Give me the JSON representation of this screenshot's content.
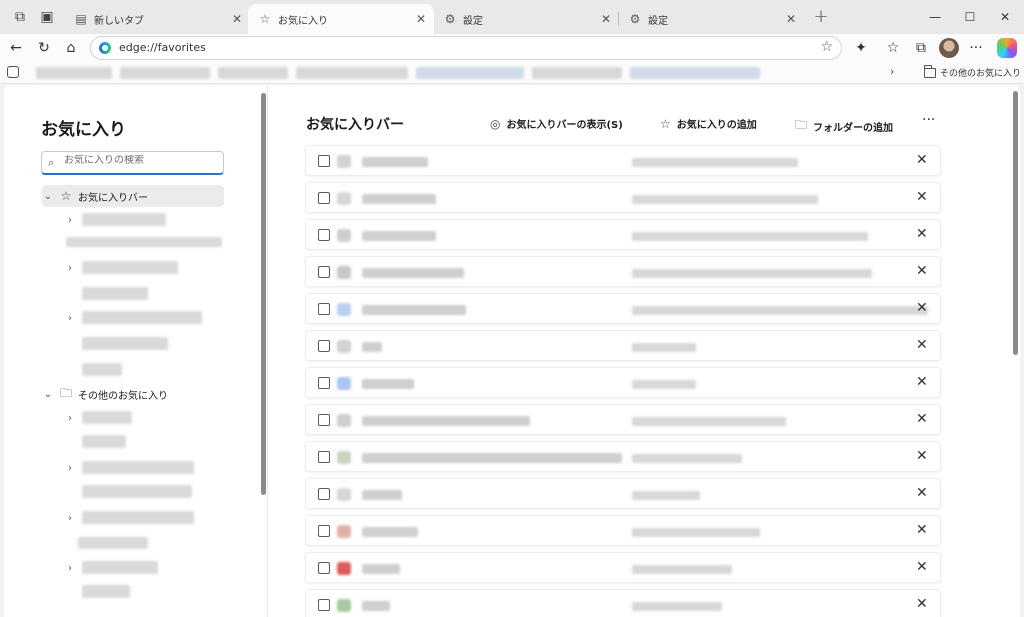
{
  "tabs": [
    {
      "label": "新しいタブ",
      "icon": "new-tab-page-icon",
      "active": false
    },
    {
      "label": "お気に入り",
      "icon": "star-icon",
      "active": true
    },
    {
      "label": "設定",
      "icon": "gear-icon",
      "active": false
    },
    {
      "label": "設定",
      "icon": "gear-icon",
      "active": false
    }
  ],
  "address": {
    "url": "edge://favorites"
  },
  "favorites_bar": {
    "other_favorites_label": "その他のお気に入り"
  },
  "sidebar": {
    "title": "お気に入り",
    "search_placeholder": "お気に入りの検索",
    "tree": {
      "favorites_bar_label": "お気に入りバー",
      "other_favorites_label": "その他のお気に入り"
    }
  },
  "main": {
    "title": "お気に入りバー",
    "actions": {
      "show_bar": "お気に入りバーの表示(S)",
      "add_favorite": "お気に入りの追加",
      "add_folder": "フォルダーの追加"
    },
    "more_label": "···"
  },
  "colors": {
    "accent": "#2b6fd6",
    "favicon_red": "#e05b5b",
    "favicon_blue": "#8fb6e8"
  }
}
